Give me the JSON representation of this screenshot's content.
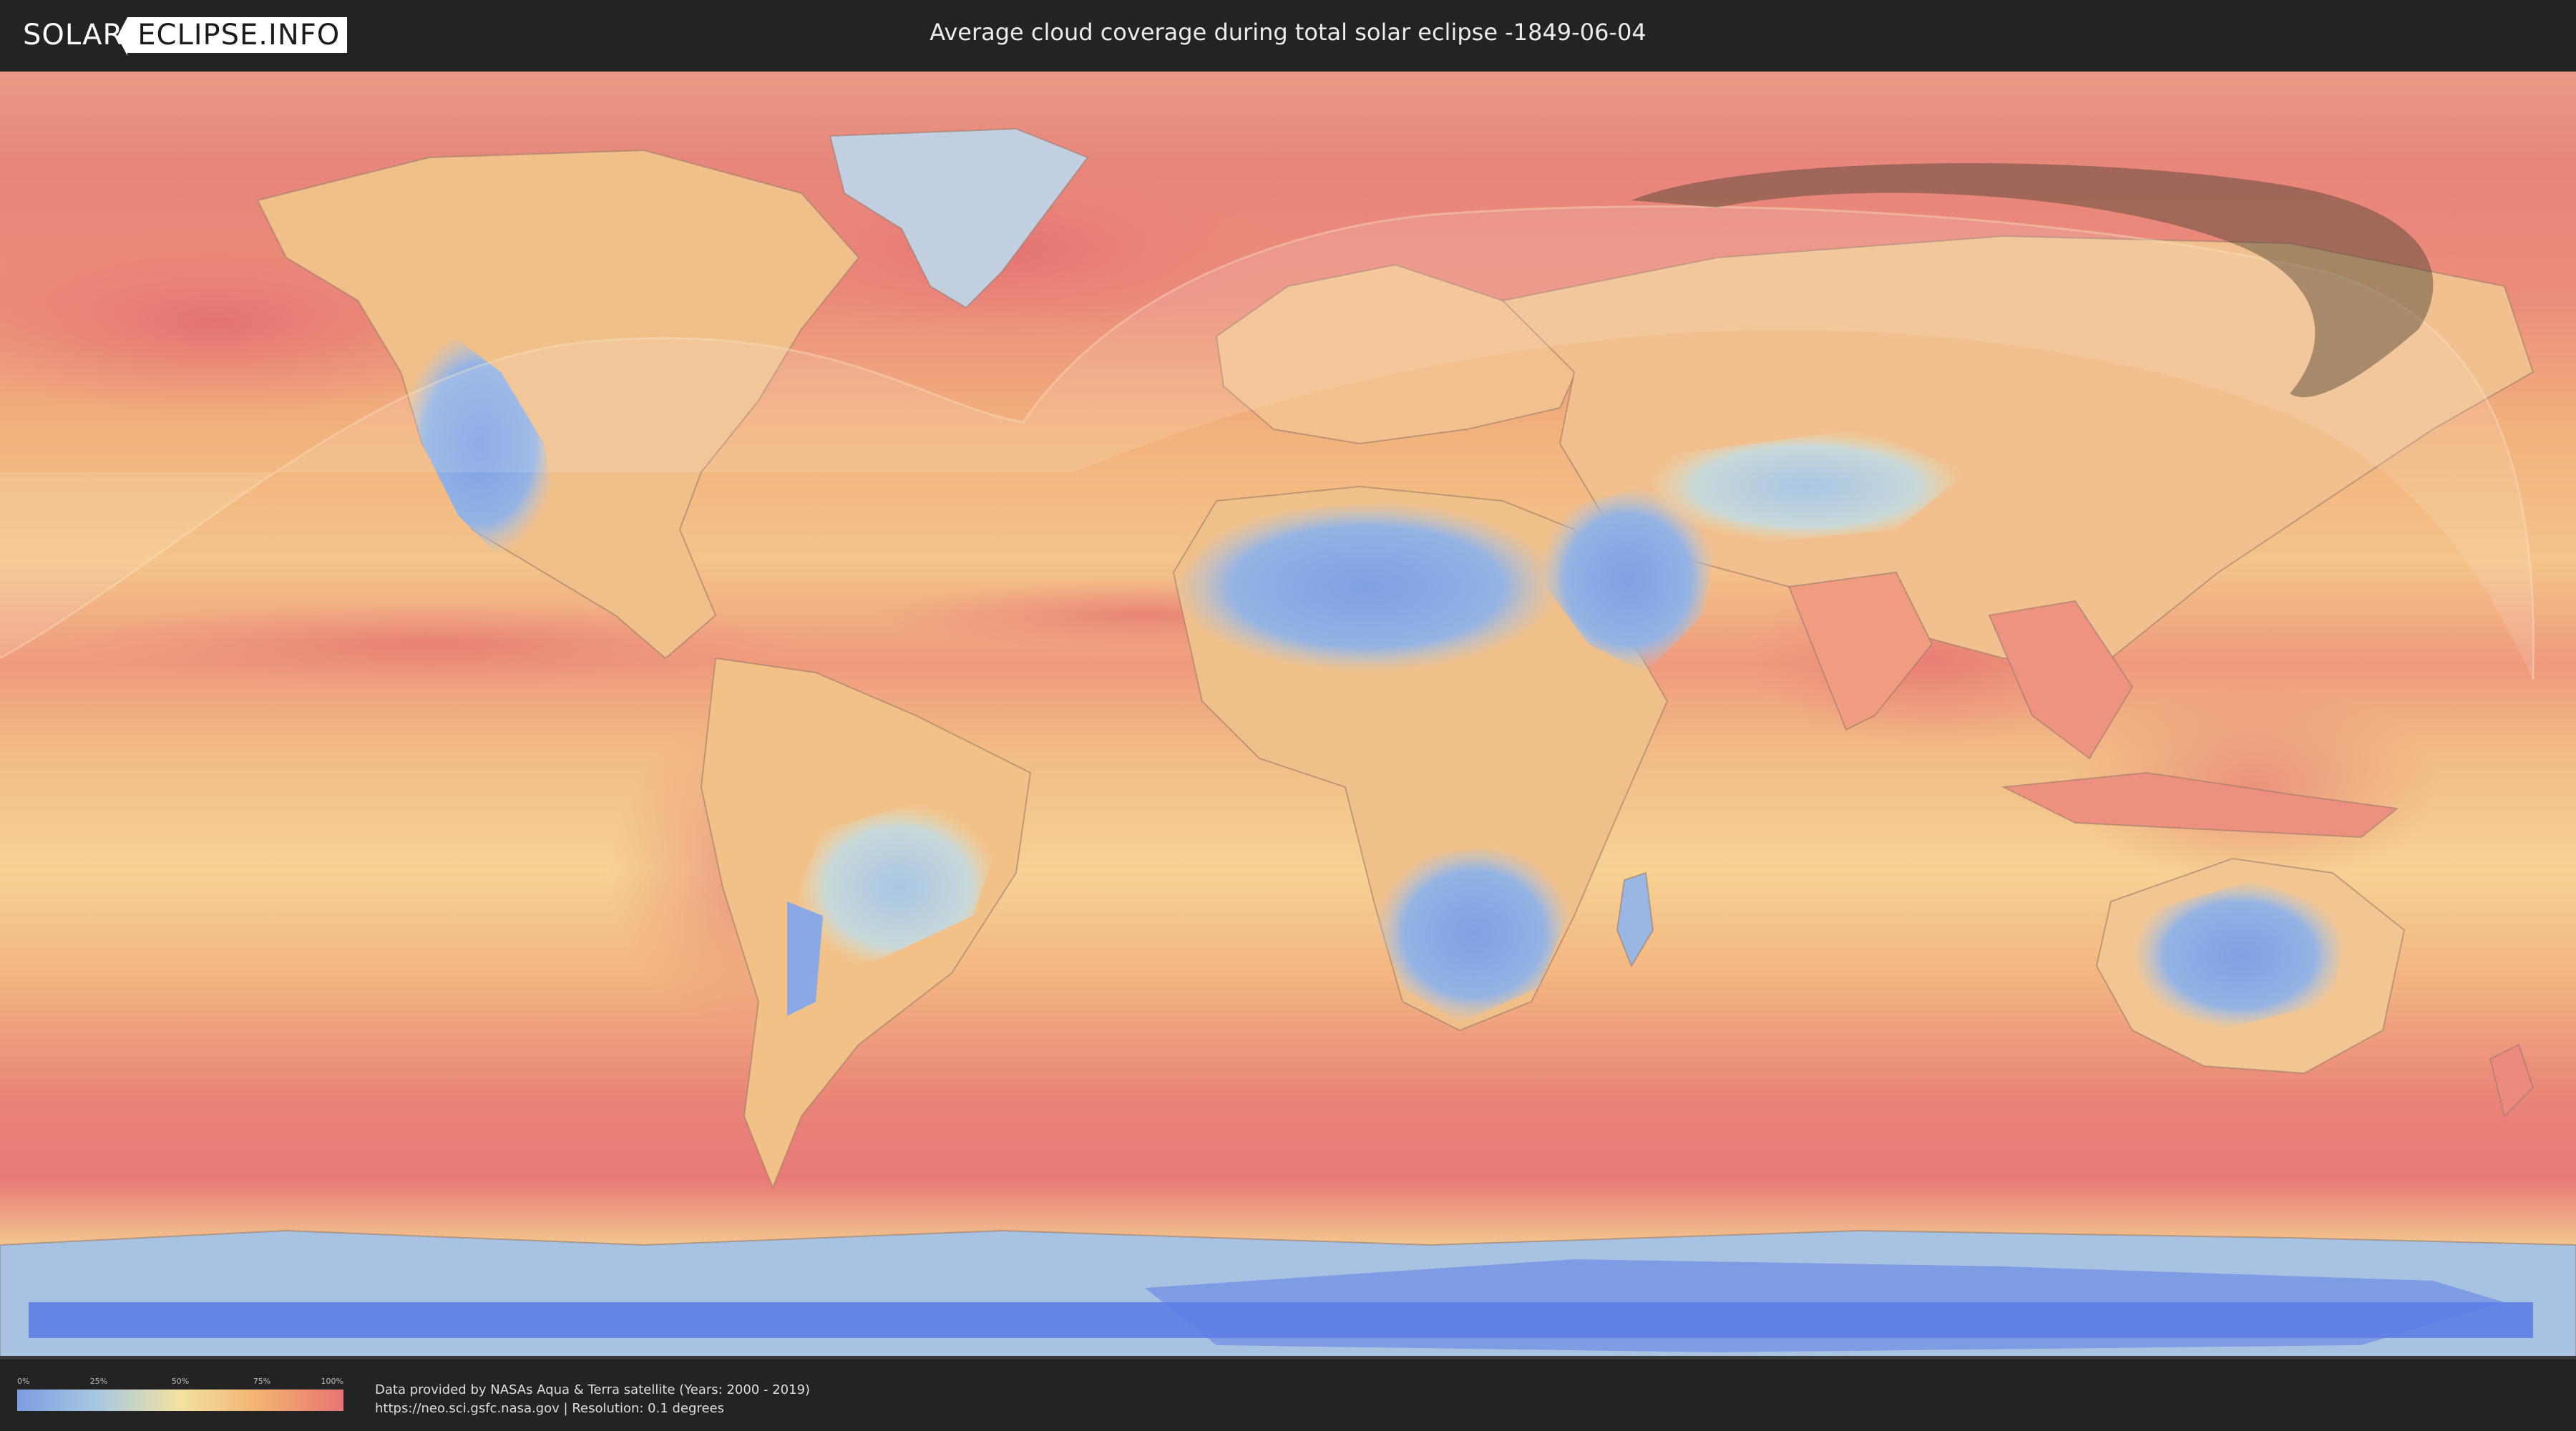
{
  "header": {
    "logo_part1": "SOLAR",
    "logo_part2": "ECLIPSE.INFO",
    "title": "Average cloud coverage during total solar eclipse -1849-06-04"
  },
  "legend": {
    "ticks": [
      "0%",
      "25%",
      "50%",
      "75%",
      "100%"
    ],
    "colors": [
      "#7c9ee0",
      "#a8c8e0",
      "#f2e2a0",
      "#f2b070",
      "#e87474"
    ]
  },
  "footer": {
    "credit_line1": "Data provided by NASAs Aqua & Terra satellite (Years: 2000 - 2019)",
    "credit_line2": "https://neo.sci.gsfc.nasa.gov | Resolution: 0.1 degrees"
  },
  "map": {
    "colors": {
      "ocean_cloudy": "#e98478",
      "ocean_mid": "#f3b27a",
      "ocean_light": "#f6d79a",
      "clear_land": "#86a6e6",
      "semi_clear": "#aecbe6",
      "polar_ice": "#5d80e6",
      "eclipse_shadow": "#4a4030"
    },
    "eclipse_path": "total solar eclipse path",
    "visibility_region": "eclipse visibility region"
  }
}
